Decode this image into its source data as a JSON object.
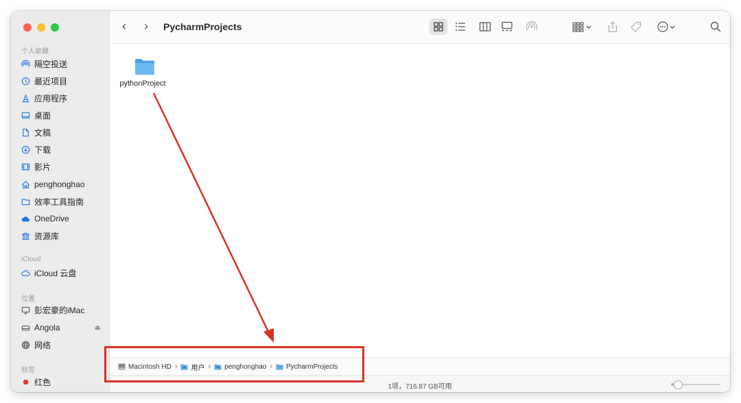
{
  "window": {
    "title": "PycharmProjects"
  },
  "traffic_lights": {
    "close": "#ff5f57",
    "minimize": "#febc2e",
    "zoom": "#28c840"
  },
  "sidebar": {
    "favorites_header": "个人收藏",
    "favorites": [
      {
        "label": "隔空投送",
        "icon": "airdrop-icon"
      },
      {
        "label": "最近项目",
        "icon": "clock-icon"
      },
      {
        "label": "应用程序",
        "icon": "applications-icon"
      },
      {
        "label": "桌面",
        "icon": "desktop-icon"
      },
      {
        "label": "文稿",
        "icon": "document-icon"
      },
      {
        "label": "下载",
        "icon": "download-icon"
      },
      {
        "label": "影片",
        "icon": "film-icon"
      },
      {
        "label": "penghonghao",
        "icon": "home-icon"
      },
      {
        "label": "效率工具指南",
        "icon": "folder-icon"
      },
      {
        "label": "OneDrive",
        "icon": "cloud-icon"
      },
      {
        "label": "资源库",
        "icon": "library-icon"
      }
    ],
    "icloud_header": "iCloud",
    "icloud": [
      {
        "label": "iCloud 云盘",
        "icon": "icloud-icon"
      }
    ],
    "locations_header": "位置",
    "locations": [
      {
        "label": "彭宏豪的iMac",
        "icon": "imac-icon"
      },
      {
        "label": "Angola",
        "icon": "drive-icon",
        "eject": "⏏"
      },
      {
        "label": "网络",
        "icon": "network-icon"
      }
    ],
    "tags_header": "标签",
    "tags": [
      {
        "label": "红色",
        "color": "#e53935"
      }
    ]
  },
  "content": {
    "items": [
      {
        "label": "pythonProject",
        "icon": "folder-icon"
      }
    ]
  },
  "pathbar": {
    "crumbs": [
      "Macintosh HD",
      "用户",
      "penghonghao",
      "PycharmProjects"
    ],
    "separator": "›"
  },
  "statusbar": {
    "text": "1项，716.87 GB可用",
    "zoom_level": 0.1
  },
  "annotation": {
    "color": "#d93025"
  }
}
